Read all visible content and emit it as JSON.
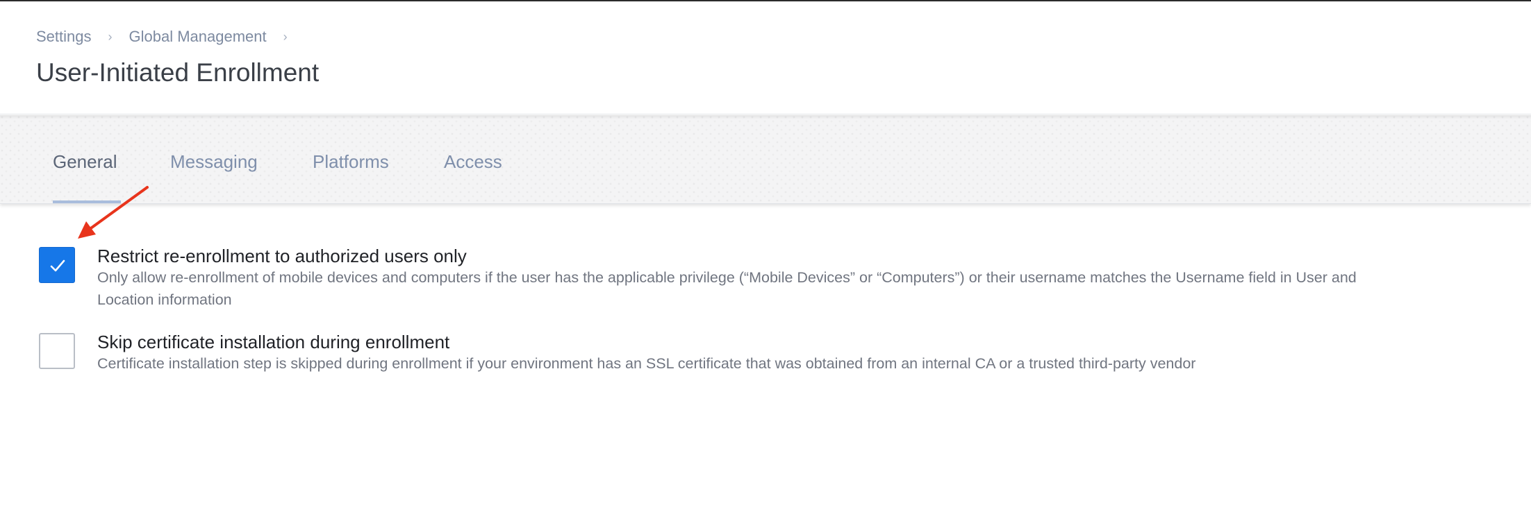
{
  "breadcrumb": {
    "items": [
      "Settings",
      "Global Management"
    ],
    "separator": "›"
  },
  "page_title": "User-Initiated Enrollment",
  "tabs": [
    {
      "label": "General",
      "active": true
    },
    {
      "label": "Messaging",
      "active": false
    },
    {
      "label": "Platforms",
      "active": false
    },
    {
      "label": "Access",
      "active": false
    }
  ],
  "options": [
    {
      "label": "Restrict re-enrollment to authorized users only",
      "description_line1": "Only allow re-enrollment of mobile devices and computers if the user has the applicable privilege (“Mobile Devices” or “Computers”) or their username matches the Username field in User and",
      "description_line2": "Location information",
      "checked": true
    },
    {
      "label": "Skip certificate installation during enrollment",
      "description_line1": "Certificate installation step is skipped during enrollment if your environment has an SSL certificate that was obtained from an internal CA or a trusted third-party vendor",
      "checked": false
    }
  ],
  "colors": {
    "accent": "#1677e8",
    "annotation_arrow": "#e8341c",
    "tab_text": "#7f8fab",
    "breadcrumb_text": "#7d8aa0"
  },
  "icons": {
    "checkmark": "checkmark-icon",
    "breadcrumb_separator": "chevron-right-icon",
    "annotation": "red-arrow-annotation"
  }
}
